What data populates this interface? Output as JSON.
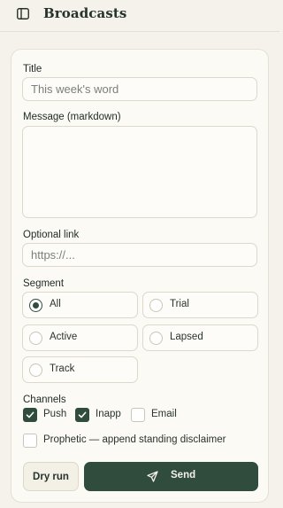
{
  "header": {
    "title": "Broadcasts",
    "sidebar_icon": "sidebar-toggle-icon"
  },
  "form": {
    "title_label": "Title",
    "title_placeholder": "This week's word",
    "message_label": "Message (markdown)",
    "message_value": "",
    "link_label": "Optional link",
    "link_placeholder": "https://...",
    "segment_label": "Segment",
    "segments": [
      {
        "label": "All",
        "selected": true
      },
      {
        "label": "Trial",
        "selected": false
      },
      {
        "label": "Active",
        "selected": false
      },
      {
        "label": "Lapsed",
        "selected": false
      },
      {
        "label": "Track",
        "selected": false
      }
    ],
    "channels_label": "Channels",
    "channels": [
      {
        "label": "Push",
        "checked": true
      },
      {
        "label": "Inapp",
        "checked": true
      },
      {
        "label": "Email",
        "checked": false
      }
    ],
    "prophetic_label": "Prophetic — append standing disclaimer",
    "prophetic_checked": false,
    "dry_run_label": "Dry run",
    "send_label": "Send",
    "send_icon": "paper-plane-icon"
  },
  "colors": {
    "accent": "#2f4c3d",
    "background": "#f4f2ea",
    "card": "#fbfaf5"
  }
}
